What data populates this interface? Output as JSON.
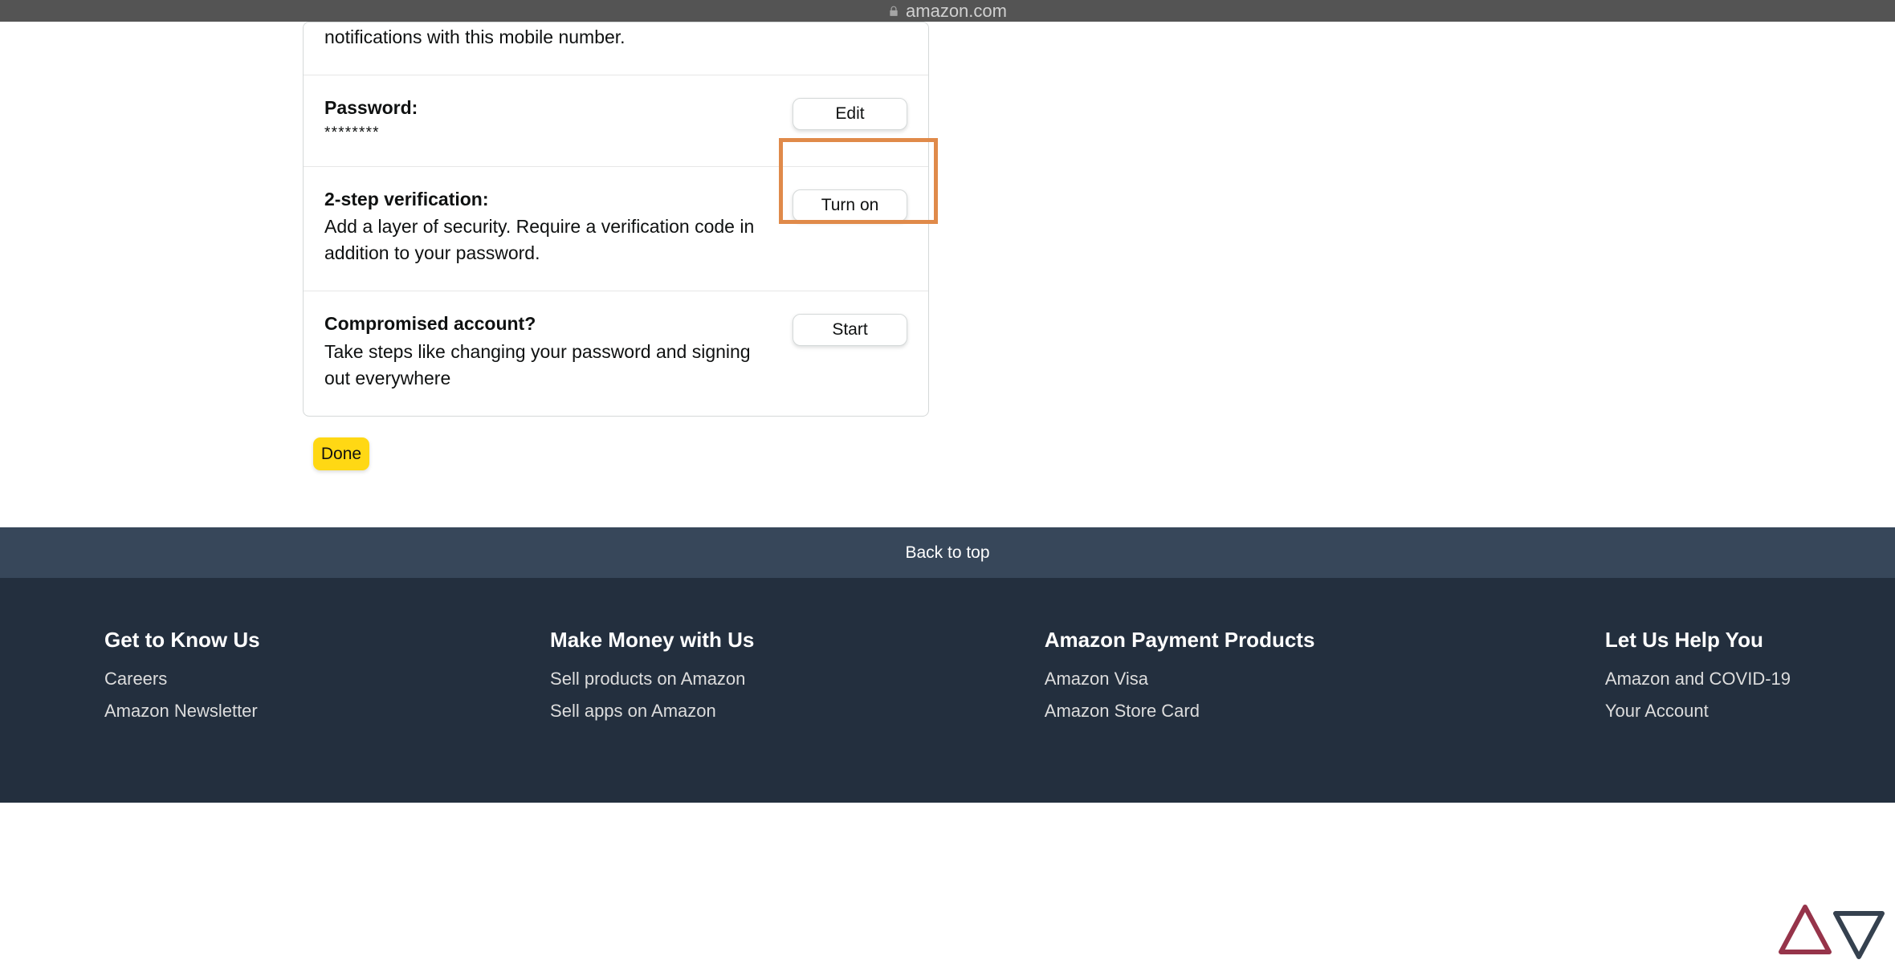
{
  "address_bar": {
    "url": "amazon.com"
  },
  "card": {
    "mobile_partial": "notifications with this mobile number.",
    "password": {
      "title": "Password:",
      "value": "********",
      "button": "Edit"
    },
    "twostep": {
      "title": "2-step verification:",
      "body": "Add a layer of security. Require a verification code in addition to your password.",
      "button": "Turn on"
    },
    "compromised": {
      "title": "Compromised account?",
      "body": "Take steps like changing your password and signing out everywhere",
      "button": "Start"
    }
  },
  "done": "Done",
  "back_to_top": "Back to top",
  "footer": {
    "col1": {
      "heading": "Get to Know Us",
      "links": [
        "Careers",
        "Amazon Newsletter"
      ]
    },
    "col2": {
      "heading": "Make Money with Us",
      "links": [
        "Sell products on Amazon",
        "Sell apps on Amazon"
      ]
    },
    "col3": {
      "heading": "Amazon Payment Products",
      "links": [
        "Amazon Visa",
        "Amazon Store Card"
      ]
    },
    "col4": {
      "heading": "Let Us Help You",
      "links": [
        "Amazon and COVID-19",
        "Your Account"
      ]
    }
  }
}
